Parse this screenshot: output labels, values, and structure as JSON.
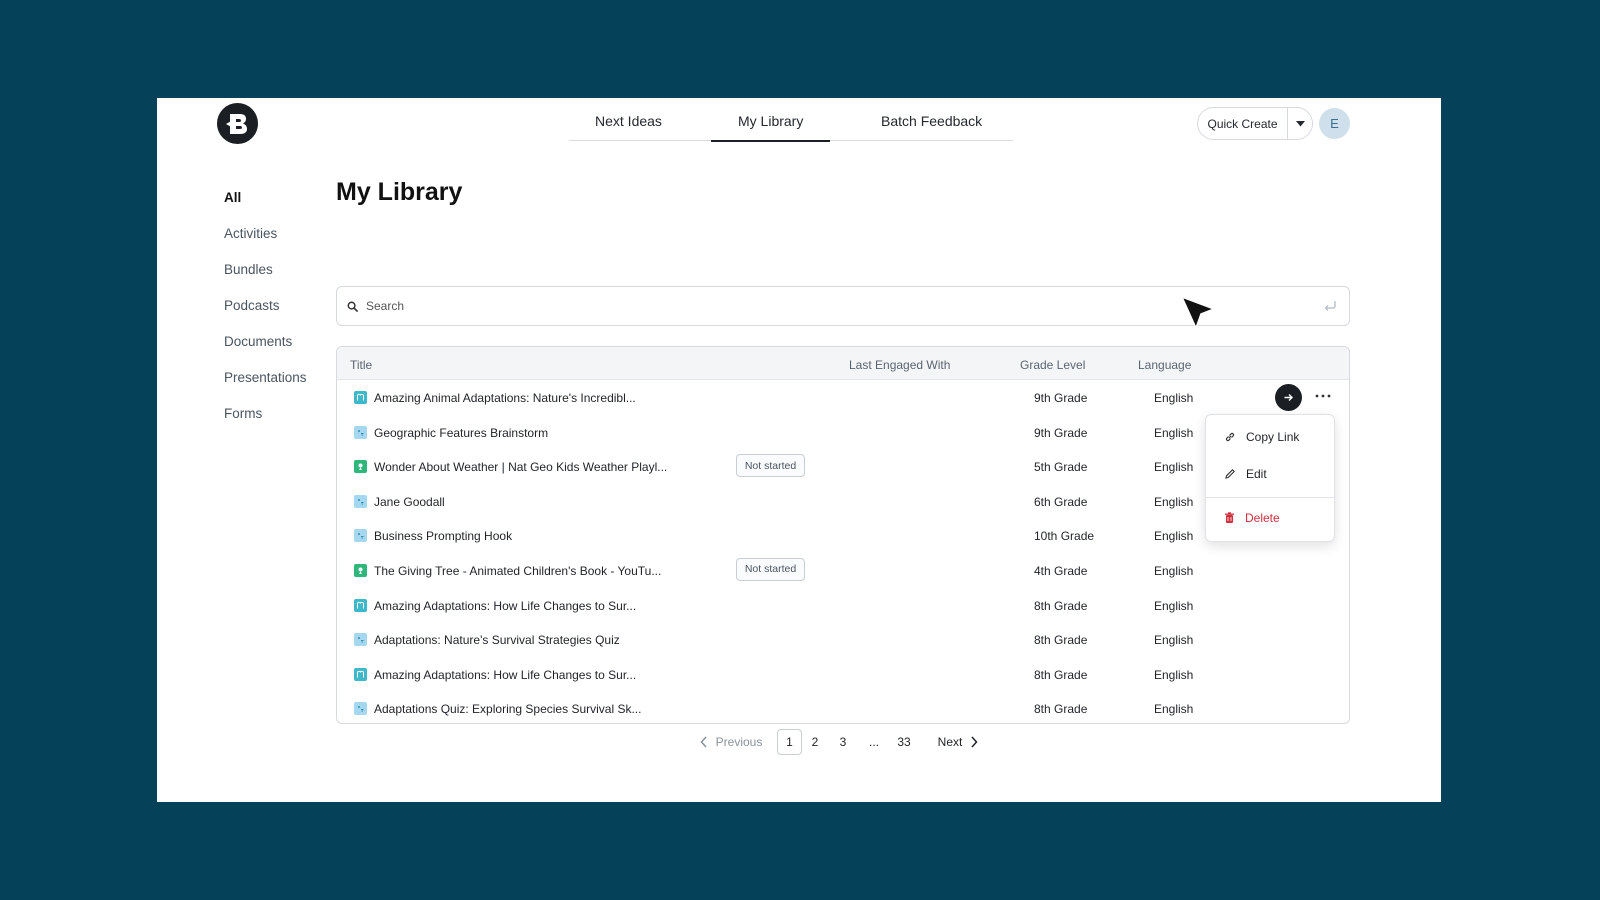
{
  "header": {
    "logo_letter": "B",
    "tabs": [
      {
        "label": "Next Ideas"
      },
      {
        "label": "My Library",
        "active": true
      },
      {
        "label": "Batch Feedback"
      }
    ],
    "quick_create_label": "Quick Create",
    "avatar_initial": "E"
  },
  "sidebar": {
    "items": [
      {
        "label": "All",
        "active": true
      },
      {
        "label": "Activities"
      },
      {
        "label": "Bundles"
      },
      {
        "label": "Podcasts"
      },
      {
        "label": "Documents"
      },
      {
        "label": "Presentations"
      },
      {
        "label": "Forms"
      }
    ]
  },
  "main": {
    "title": "My Library",
    "search_placeholder": "Search"
  },
  "table": {
    "headers": {
      "title": "Title",
      "last_engaged": "Last Engaged With",
      "grade": "Grade Level",
      "language": "Language"
    },
    "rows": [
      {
        "icon": "book-icon",
        "title": "Amazing Animal Adaptations: Nature's Incredibl...",
        "status": "",
        "grade": "9th Grade",
        "language": "English"
      },
      {
        "icon": "activity-icon",
        "title": "Geographic Features Brainstorm",
        "status": "",
        "grade": "9th Grade",
        "language": "English"
      },
      {
        "icon": "video-icon",
        "title": "Wonder About Weather | Nat Geo Kids Weather Playl...",
        "status": "Not started",
        "grade": "5th Grade",
        "language": "English"
      },
      {
        "icon": "activity-icon",
        "title": "Jane Goodall",
        "status": "",
        "grade": "6th Grade",
        "language": "English"
      },
      {
        "icon": "activity-icon",
        "title": "Business Prompting Hook",
        "status": "",
        "grade": "10th Grade",
        "language": "English"
      },
      {
        "icon": "video-icon",
        "title": "The Giving Tree - Animated Children's Book - YouTu...",
        "status": "Not started",
        "grade": "4th Grade",
        "language": "English"
      },
      {
        "icon": "book-icon",
        "title": "Amazing Adaptations: How Life Changes to Sur...",
        "status": "",
        "grade": "8th Grade",
        "language": "English"
      },
      {
        "icon": "activity-icon",
        "title": "Adaptations: Nature's Survival Strategies Quiz",
        "status": "",
        "grade": "8th Grade",
        "language": "English"
      },
      {
        "icon": "book-icon",
        "title": "Amazing Adaptations: How Life Changes to Sur...",
        "status": "",
        "grade": "8th Grade",
        "language": "English"
      },
      {
        "icon": "activity-icon",
        "title": "Adaptations Quiz: Exploring Species Survival Sk...",
        "status": "",
        "grade": "8th Grade",
        "language": "English"
      }
    ]
  },
  "row_menu": {
    "items": [
      {
        "label": "Copy Link",
        "icon": "link-icon"
      },
      {
        "label": "Edit",
        "icon": "pencil-icon"
      },
      {
        "label": "Delete",
        "icon": "trash-icon",
        "danger": true
      }
    ]
  },
  "pagination": {
    "previous": "Previous",
    "pages": [
      "1",
      "2",
      "3",
      "...",
      "33"
    ],
    "current": "1",
    "next": "Next"
  },
  "colors": {
    "background": "#05425a",
    "accent_teal": "#3fb8c9",
    "accent_green": "#2fb67a",
    "danger": "#d0303c"
  }
}
